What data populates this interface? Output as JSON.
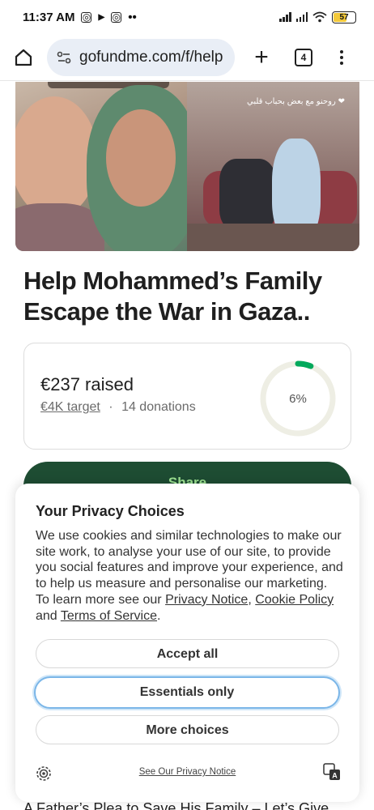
{
  "status_bar": {
    "time": "11:37 AM",
    "battery": "57",
    "dots": "••"
  },
  "browser": {
    "url": "gofundme.com/f/help",
    "tab_count": "4",
    "plus": "+"
  },
  "hero": {
    "caption": "روحنو مع بعض بحباب قلبي ❤"
  },
  "campaign": {
    "title": "Help Mohammed’s Family Escape the War in Gaza..",
    "raised": "€237 raised",
    "target": "€4K target",
    "separator": "·",
    "donations": "14 donations",
    "progress_percent": 6,
    "progress_label": "6%",
    "share_label": "Share"
  },
  "privacy": {
    "title": "Your Privacy Choices",
    "body_intro": "We use cookies and similar technologies to make our site work, to analyse your use of our site, to provide you social features and improve your experience, and to help us measure and personalise our marketing. To learn more see our ",
    "privacy_notice_link": "Privacy Notice",
    "comma": ", ",
    "cookie_policy_link": "Cookie Policy",
    "and": " and ",
    "terms_link": "Terms of Service",
    "period": ".",
    "accept_all": "Accept all",
    "essentials_only": "Essentials only",
    "more_choices": "More choices",
    "see_notice": "See Our Privacy Notice"
  },
  "below": {
    "text": "A Father’s Plea to Save His Family – Let’s Give"
  },
  "colors": {
    "accent_green": "#1e4d33",
    "progress_green": "#02a95c",
    "focus_blue": "#7bb6e8",
    "url_bg": "#e9eef6"
  }
}
